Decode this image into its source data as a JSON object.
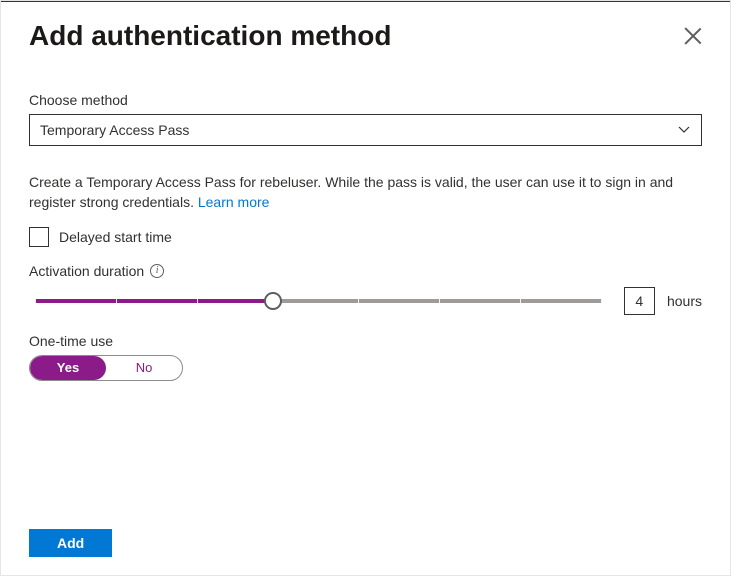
{
  "header": {
    "title": "Add authentication method"
  },
  "method": {
    "label": "Choose method",
    "selected": "Temporary Access Pass"
  },
  "description": {
    "text": "Create a Temporary Access Pass for rebeluser. While the pass is valid, the user can use it to sign in and register strong credentials. ",
    "learn_more": "Learn more"
  },
  "delayed_start": {
    "label": "Delayed start time",
    "checked": false
  },
  "duration": {
    "label": "Activation duration",
    "value": "4",
    "unit": "hours"
  },
  "one_time": {
    "label": "One-time use",
    "yes": "Yes",
    "no": "No"
  },
  "footer": {
    "add": "Add"
  }
}
